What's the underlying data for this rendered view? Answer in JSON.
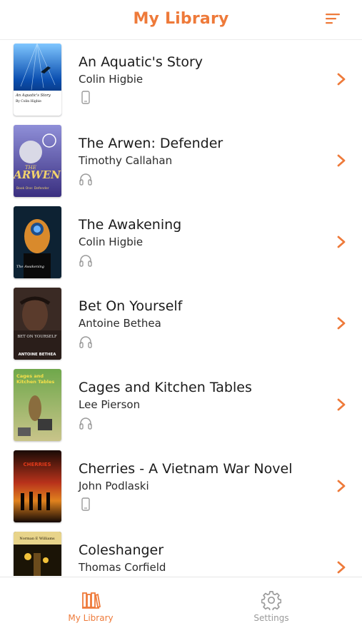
{
  "header": {
    "title": "My Library",
    "sort_icon": "sort-lines-icon"
  },
  "colors": {
    "accent": "#EE7A3A",
    "text": "#1B1B1B",
    "muted": "#9A9A9A"
  },
  "books": [
    {
      "title": "An Aquatic's Story",
      "author": "Colin Higbie",
      "format_icon": "phone-icon"
    },
    {
      "title": "The Arwen: Defender",
      "author": "Timothy Callahan",
      "format_icon": "headphones-icon"
    },
    {
      "title": "The Awakening",
      "author": "Colin Higbie",
      "format_icon": "headphones-icon"
    },
    {
      "title": "Bet On Yourself",
      "author": "Antoine Bethea",
      "format_icon": "headphones-icon"
    },
    {
      "title": "Cages and Kitchen Tables",
      "author": "Lee Pierson",
      "format_icon": "headphones-icon"
    },
    {
      "title": "Cherries - A Vietnam War Novel",
      "author": "John Podlaski",
      "format_icon": "phone-icon"
    },
    {
      "title": "Coleshanger",
      "author": "Thomas Corfield",
      "format_icon": ""
    }
  ],
  "covers": [
    {
      "lines": [
        "An Aquatic's Story",
        "By Colin Higbie"
      ]
    },
    {
      "lines": [
        "THE",
        "ARWEN",
        "Book One: Defender"
      ]
    },
    {
      "lines": [
        "The Awakening"
      ]
    },
    {
      "lines": [
        "BET ON YOURSELF",
        "ANTOINE BETHEA"
      ]
    },
    {
      "lines": [
        "Cages and",
        "Kitchen Tables"
      ]
    },
    {
      "lines": [
        "CHERRIES"
      ]
    },
    {
      "lines": [
        "Norman E Williams"
      ]
    }
  ],
  "tabs": [
    {
      "label": "My Library",
      "icon": "books-icon",
      "active": true
    },
    {
      "label": "Settings",
      "icon": "gear-icon",
      "active": false
    }
  ]
}
